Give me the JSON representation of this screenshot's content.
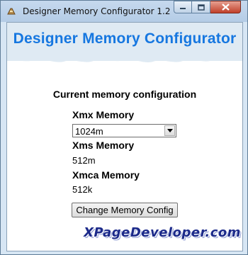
{
  "window": {
    "title": "Designer Memory Configurator 1.2",
    "controls": {
      "minimize": "minimize",
      "maximize": "maximize",
      "close": "close"
    }
  },
  "banner": {
    "title": "Designer Memory Configurator"
  },
  "config": {
    "section_title": "Current memory configuration",
    "xmx_label": "Xmx Memory",
    "xmx_selected": "1024m",
    "xms_label": "Xms Memory",
    "xms_value": "512m",
    "xmca_label": "Xmca Memory",
    "xmca_value": "512k"
  },
  "actions": {
    "change_button": "Change Memory Config"
  },
  "branding": {
    "text": "XPageDeveloper.com"
  },
  "colors": {
    "accent": "#1677e0",
    "brand": "#1c2a8a",
    "close_button": "#c0402a"
  }
}
